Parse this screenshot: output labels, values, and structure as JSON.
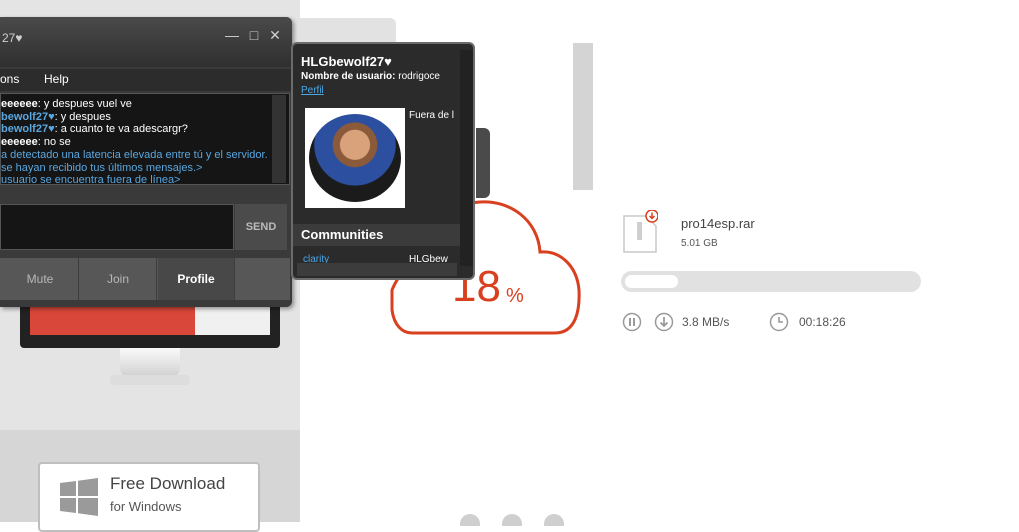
{
  "chat_window": {
    "title": "27♥",
    "menu": [
      "ons",
      "Help"
    ],
    "log": [
      {
        "name": "eeeeee",
        "text": ": y despues vuel ve",
        "name_color": "#ffffff"
      },
      {
        "name": "bewolf27♥",
        "text": ": y despues",
        "name_color": "#5aa7e0"
      },
      {
        "name": "bewolf27♥",
        "text": ": a cuanto te va adescargr?",
        "name_color": "#5aa7e0"
      },
      {
        "name": "eeeeee",
        "text": ": no se",
        "name_color": "#ffffff"
      },
      {
        "name": "",
        "text": "a detectado una latencia elevada entre tú y el servidor.",
        "name_color": "#5aa7e0"
      },
      {
        "name": "",
        "text": "se hayan recibido tus últimos mensajes.>",
        "name_color": "#5aa7e0"
      },
      {
        "name": "",
        "text": " usuario se encuentra fuera de línea>",
        "name_color": "#5aa7e0"
      }
    ],
    "send_label": "SEND",
    "toolbar": [
      "Mute",
      "Join",
      "Profile"
    ]
  },
  "profile_popup": {
    "name": "HLGbewolf27♥",
    "username_label": "Nombre de usuario:",
    "username_value": " rodrigoce",
    "profile_link": "Perfil",
    "status": "Fuera de l",
    "communities_header": "Communities",
    "community_1": "clarity",
    "community_2": "HLGbew"
  },
  "download": {
    "percent": "18",
    "percent_sign": "%",
    "file_name": "pro14esp.rar",
    "file_size": "5.01 GB",
    "progress_fraction": 0.18,
    "speed": "3.8 MB/s",
    "time_remaining": "00:18:26",
    "accent_color": "#d8401f"
  },
  "free_download": {
    "title": "Free Download",
    "subtitle": "for Windows"
  }
}
